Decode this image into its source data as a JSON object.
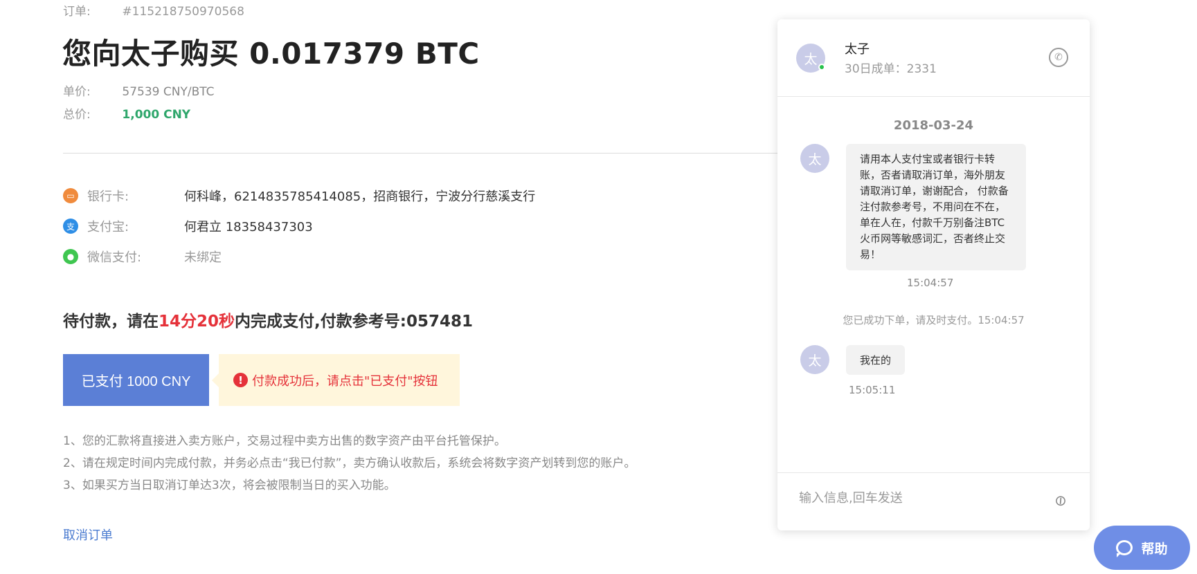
{
  "order": {
    "id_label": "订单:",
    "id_value": "#115218750970568",
    "title": "您向太子购买 0.017379 BTC",
    "unit_price_label": "单价:",
    "unit_price_value": "57539 CNY/BTC",
    "total_label": "总价:",
    "total_value": "1,000 CNY"
  },
  "payment_methods": [
    {
      "label": "银行卡:",
      "value": "何科峰，6214835785414085，招商银行，宁波分行慈溪支行",
      "icon": "bank-card-icon",
      "color": "#f08b3d"
    },
    {
      "label": "支付宝:",
      "value": "何君立 18358437303",
      "icon": "alipay-icon",
      "color": "#2e8ee6"
    },
    {
      "label": "微信支付:",
      "value": "未绑定",
      "icon": "wechat-icon",
      "color": "#3fc650"
    }
  ],
  "countdown": {
    "prefix": "待付款，请在",
    "time": "14分20秒",
    "suffix": "内完成支付,付款参考号:057481"
  },
  "actions": {
    "paid_button": "已支付 1000 CNY",
    "tip": "付款成功后，请点击\"已支付\"按钮",
    "cancel_link": "取消订单"
  },
  "notes": [
    "1、您的汇款将直接进入卖方账户，交易过程中卖方出售的数字资产由平台托管保护。",
    "2、请在规定时间内完成付款，并务必点击“我已付款”，卖方确认收款后，系统会将数字资产划转到您的账户。",
    "3、如果买方当日取消订单达3次，将会被限制当日的买入功能。"
  ],
  "chat": {
    "peer_name": "太子",
    "peer_avatar": "太",
    "peer_stat": "30日成单：2331",
    "date": "2018-03-24",
    "messages": [
      {
        "text": "请用本人支付宝或者银行卡转账，否者请取消订单，海外朋友请取消订单，谢谢配合， 付款备注付款参考号，不用问在不在，单在人在，付款千万别备注BTC 火币网等敏感词汇，否者终止交易！",
        "time": "15:04:57"
      },
      {
        "text": "我在的",
        "time": "15:05:11"
      }
    ],
    "system_message": "您已成功下单，请及时支付。15:04:57",
    "input_placeholder": "输入信息,回车发送"
  },
  "help_button": "帮助",
  "colors": {
    "accent_blue": "#5b7fd6",
    "alert_red": "#e5323a",
    "total_green": "#2ea66b",
    "tip_bg": "#fff6dc"
  }
}
